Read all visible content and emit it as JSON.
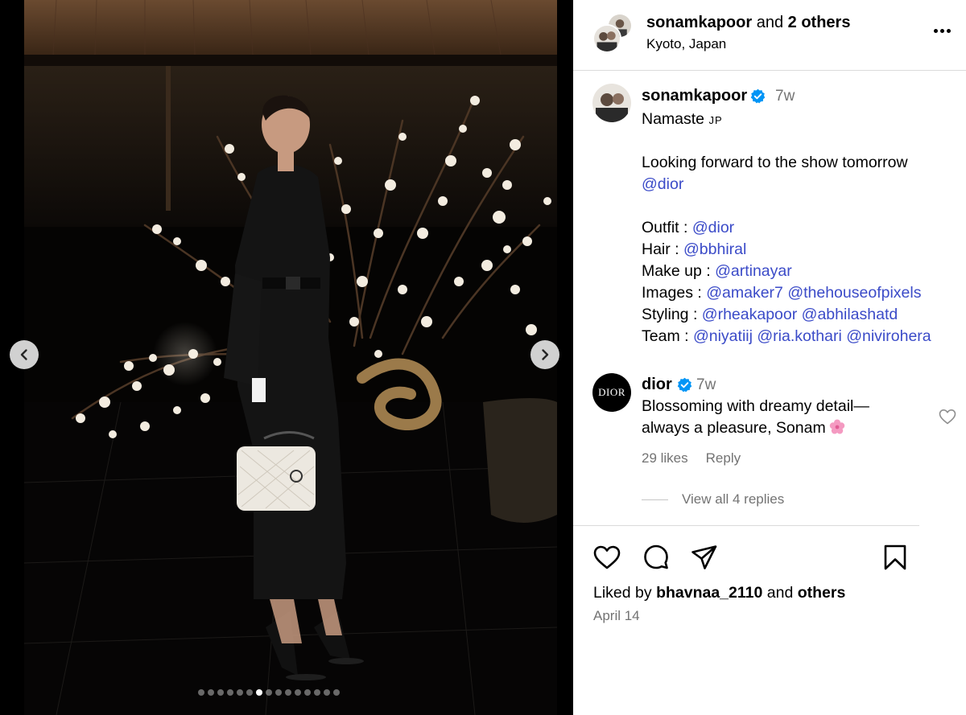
{
  "header": {
    "username": "sonamkapoor",
    "joiner": "and",
    "others": "2 others",
    "location": "Kyoto, Japan",
    "more_icon": "more-horizontal-icon"
  },
  "carousel": {
    "prev_icon": "chevron-left-icon",
    "next_icon": "chevron-right-icon",
    "slide_count": 15,
    "active_index": 6
  },
  "caption": {
    "username": "sonamkapoor",
    "verified_icon": "verified-badge-icon",
    "time": "7w",
    "greeting": "Namaste",
    "flag": "JP",
    "line_show": "Looking forward to the show tomorrow",
    "line_show_mention": "@dior",
    "outfit_label": "Outfit :",
    "outfit_mentions": [
      "@dior"
    ],
    "hair_label": "Hair :",
    "hair_mentions": [
      "@bbhiral"
    ],
    "makeup_label": "Make up :",
    "makeup_mentions": [
      "@artinayar"
    ],
    "images_label": "Images :",
    "images_mentions": [
      "@amaker7",
      "@thehouseofpixels"
    ],
    "styling_label": "Styling :",
    "styling_mentions": [
      "@rheakapoor",
      "@abhilashatd"
    ],
    "team_label": "Team :",
    "team_mentions": [
      "@niyatiij",
      "@ria.kothari",
      "@nivirohera"
    ]
  },
  "comment": {
    "avatar_text": "DIOR",
    "username": "dior",
    "time": "7w",
    "line1": "Blossoming with dreamy detail—",
    "line2": "always a pleasure, Sonam",
    "emoji_icon": "cherry-blossom-icon",
    "likes": "29 likes",
    "reply": "Reply",
    "view_replies": "View all 4 replies",
    "like_icon": "heart-icon"
  },
  "actions": {
    "like_icon": "heart-icon",
    "comment_icon": "comment-icon",
    "share_icon": "send-icon",
    "save_icon": "bookmark-icon"
  },
  "likes": {
    "prefix": "Liked by",
    "user": "bhavnaa_2110",
    "joiner": "and",
    "others": "others"
  },
  "date": "April 14",
  "colors": {
    "link": "#3b4bc8",
    "muted": "#737373",
    "verified": "#0095f6",
    "divider": "#dbdbdb"
  }
}
